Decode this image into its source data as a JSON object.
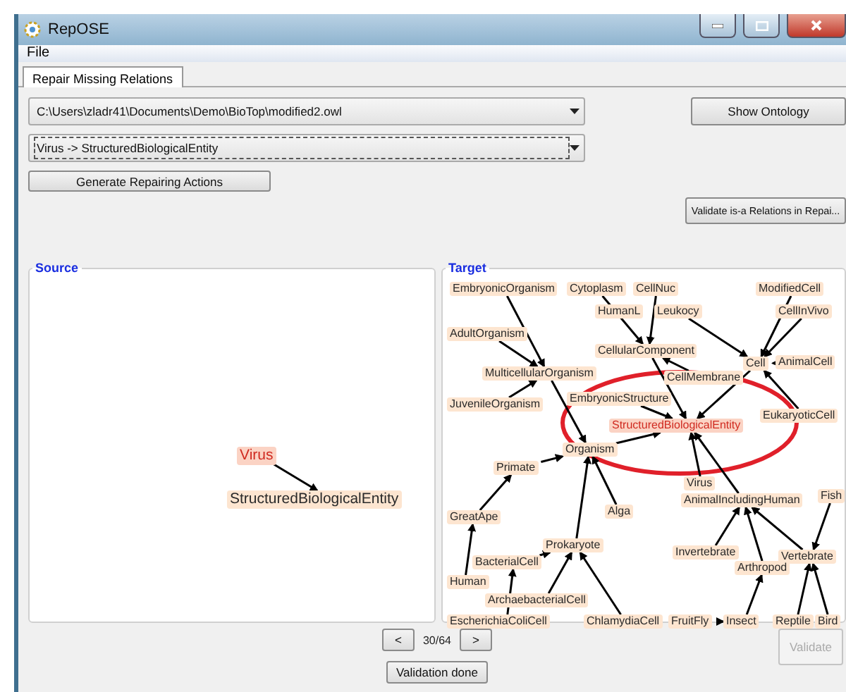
{
  "window": {
    "title": "RepOSE"
  },
  "menu": [
    "File"
  ],
  "tabs": [
    {
      "label": "Repair Missing Relations",
      "selected": true
    }
  ],
  "ontology_select": {
    "value": "C:\\Users\\zladr41\\Documents\\Demo\\BioTop\\modified2.owl",
    "focused": false
  },
  "relation_select": {
    "value": "Virus -> StructuredBiologicalEntity",
    "focused": true
  },
  "buttons": {
    "generate": "Generate Repairing Actions",
    "show_ontology": "Show Ontology",
    "validate_relations": "Validate is-a Relations in Repai..."
  },
  "source": {
    "title": "Source",
    "nodes": [
      {
        "label": "Virus",
        "highlighted": true
      },
      {
        "label": "StructuredBiologicalEntity",
        "highlighted": false
      }
    ]
  },
  "target": {
    "title": "Target",
    "nodes": [
      {
        "label": "EmbryonicOrganism",
        "highlighted": false
      },
      {
        "label": "Cytoplasm",
        "highlighted": false
      },
      {
        "label": "HumanL",
        "highlighted": false
      },
      {
        "label": "CellNuc",
        "highlighted": false
      },
      {
        "label": "Leukocy",
        "highlighted": false
      },
      {
        "label": "ModifiedCell",
        "highlighted": false
      },
      {
        "label": "CellInVivo",
        "highlighted": false
      },
      {
        "label": "AdultOrganism",
        "highlighted": false
      },
      {
        "label": "CellularComponent",
        "highlighted": false
      },
      {
        "label": "Cell",
        "highlighted": false
      },
      {
        "label": "AnimalCell",
        "highlighted": false
      },
      {
        "label": "MulticellularOrganism",
        "highlighted": false
      },
      {
        "label": "CellMembrane",
        "highlighted": false
      },
      {
        "label": "JuvenileOrganism",
        "highlighted": false
      },
      {
        "label": "EmbryonicStructure",
        "highlighted": false
      },
      {
        "label": "EukaryoticCell",
        "highlighted": false
      },
      {
        "label": "StructuredBiologicalEntity",
        "highlighted": true
      },
      {
        "label": "Organism",
        "highlighted": false
      },
      {
        "label": "Primate",
        "highlighted": false
      },
      {
        "label": "Virus",
        "highlighted": false
      },
      {
        "label": "AnimalIncludingHuman",
        "highlighted": false
      },
      {
        "label": "Fish",
        "highlighted": false
      },
      {
        "label": "Alga",
        "highlighted": false
      },
      {
        "label": "GreatApe",
        "highlighted": false
      },
      {
        "label": "Prokaryote",
        "highlighted": false
      },
      {
        "label": "Invertebrate",
        "highlighted": false
      },
      {
        "label": "Vertebrate",
        "highlighted": false
      },
      {
        "label": "BacterialCell",
        "highlighted": false
      },
      {
        "label": "Arthropod",
        "highlighted": false
      },
      {
        "label": "Human",
        "highlighted": false
      },
      {
        "label": "ArchaebacterialCell",
        "highlighted": false
      },
      {
        "label": "EscherichiaColiCell",
        "highlighted": false
      },
      {
        "label": "ChlamydiaCell",
        "highlighted": false
      },
      {
        "label": "FruitFly",
        "highlighted": false
      },
      {
        "label": "Insect",
        "highlighted": false
      },
      {
        "label": "Reptile",
        "highlighted": false
      },
      {
        "label": "Bird",
        "highlighted": false
      }
    ]
  },
  "pager": {
    "prev": "<",
    "position": "30/64",
    "next": ">"
  },
  "validate": {
    "label": "Validate",
    "disabled": true
  },
  "status_button": "Validation done"
}
